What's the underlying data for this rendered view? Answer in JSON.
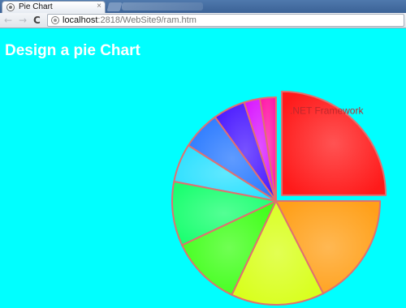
{
  "browser": {
    "tab_title": "Pie Chart",
    "tab_close": "×",
    "url_host": "localhost",
    "url_rest": ":2818/WebSite9/ram.htm",
    "nav_back": "←",
    "nav_forward": "→",
    "nav_reload": "C"
  },
  "page": {
    "title": "Design a pie Chart"
  },
  "chart_data": {
    "type": "pie",
    "title": "",
    "slices": [
      {
        "label": ".NET Framework",
        "value": 25.0,
        "color": "#ff1a1a",
        "exploded": true
      },
      {
        "label": "",
        "value": 2.5,
        "color": "#ff1aa8"
      },
      {
        "label": "",
        "value": 2.5,
        "color": "#d81aff"
      },
      {
        "label": "",
        "value": 5.0,
        "color": "#4a1aff"
      },
      {
        "label": "",
        "value": 6.0,
        "color": "#2a7aff"
      },
      {
        "label": "",
        "value": 6.0,
        "color": "#2ae0ff"
      },
      {
        "label": "",
        "value": 10.0,
        "color": "#1aff70"
      },
      {
        "label": "",
        "value": 11.0,
        "color": "#40ff1a"
      },
      {
        "label": "",
        "value": 14.5,
        "color": "#d8ff1a"
      },
      {
        "label": "",
        "value": 17.5,
        "color": "#ffa01a"
      }
    ]
  }
}
